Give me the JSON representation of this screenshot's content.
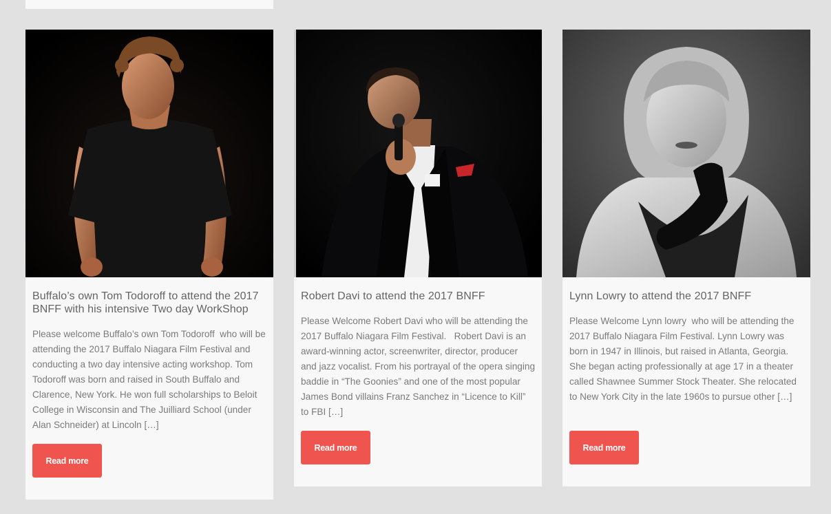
{
  "posts": [
    {
      "title": "Buffalo’s own Tom Todoroff to attend the 2017 BNFF with his intensive Two day WorkShop",
      "excerpt": "Please welcome Buffalo’s own Tom Todoroff  who will be attending the 2017 Buffalo Niagara Film Festival and conducting a two day intensive acting workshop. Tom Todoroff was born and raised in South Buffalo and Clarence, New York. He won full scholarships to Beloit College in Wisconsin and The Juilliard School (under Alan Schneider) at Lincoln […]",
      "read_more_label": "Read more"
    },
    {
      "title": "Robert Davi to attend the 2017 BNFF",
      "excerpt": "Please Welcome Robert Davi who will be attending the 2017 Buffalo Niagara Film Festival.   Robert Davi is an award-winning actor, screenwriter, director, producer and jazz vocalist. From his portrayal of the opera singing baddie in “The Goonies” and one of the most popular James Bond villains Franz Sanchez in “Licence to Kill” to FBI […]",
      "read_more_label": "Read more"
    },
    {
      "title": "Lynn Lowry to attend the 2017 BNFF",
      "excerpt": "Please Welcome Lynn lowry  who will be attending the 2017 Buffalo Niagara Film Festival. Lynn Lowry was born in 1947 in Illinois, but raised in Atlanta, Georgia. She began acting professionally at age 17 in a theater called Shawnee Summer Stock Theater. She relocated to New York City in the late 1960s to pursue other […]",
      "read_more_label": "Read more"
    }
  ],
  "colors": {
    "page_background": "#e1e1e1",
    "card_background": "#f8f8f8",
    "button": "#f0544f",
    "title_text": "#646464",
    "body_text": "#7a7a7a"
  }
}
